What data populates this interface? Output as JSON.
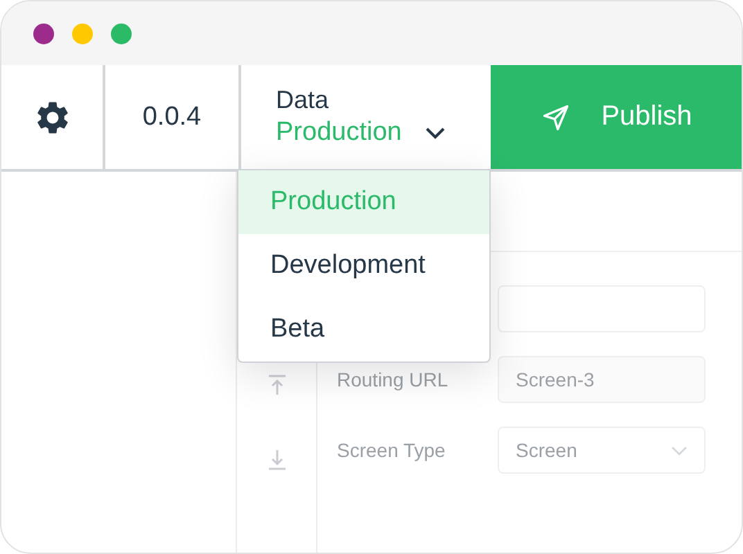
{
  "window": {
    "controls": [
      {
        "color": "#9c2b8c"
      },
      {
        "color": "#ffc800"
      },
      {
        "color": "#2bbb66"
      }
    ]
  },
  "toolbar": {
    "version": "0.0.4",
    "data_selector": {
      "label": "Data",
      "value": "Production",
      "expanded": true
    },
    "publish_button": "Publish"
  },
  "dropdown": {
    "options": [
      {
        "label": "Production",
        "selected": true
      },
      {
        "label": "Development",
        "selected": false
      },
      {
        "label": "Beta",
        "selected": false
      }
    ]
  },
  "form": {
    "fields": [
      {
        "kind": "text"
      },
      {
        "kind": "text",
        "label": "Routing URL",
        "value": "Screen-3"
      },
      {
        "kind": "select",
        "label": "Screen Type",
        "value": "Screen"
      }
    ]
  }
}
